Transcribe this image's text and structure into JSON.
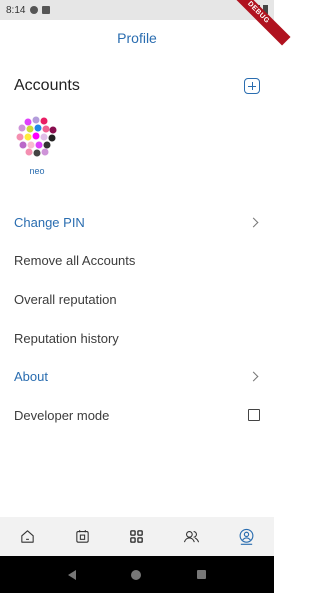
{
  "status_bar": {
    "time": "8:14",
    "debug_label": "DEBUG"
  },
  "app_bar": {
    "title": "Profile"
  },
  "accounts": {
    "title": "Accounts",
    "add_icon": "add-square-icon",
    "items": [
      {
        "name": "neo"
      }
    ]
  },
  "menu": {
    "change_pin": "Change PIN",
    "remove_accounts": "Remove all Accounts",
    "overall_reputation": "Overall reputation",
    "reputation_history": "Reputation history",
    "about": "About",
    "developer_mode": "Developer mode",
    "developer_mode_enabled": false
  },
  "bottom_nav": {
    "items": [
      "home-icon",
      "wallet-icon",
      "qr-scan-icon",
      "contacts-icon",
      "profile-icon"
    ],
    "active": "profile-icon"
  },
  "colors": {
    "accent": "#2a6db0",
    "text": "#3c3c3c",
    "nav_bg": "#f2f2f2",
    "ribbon": "#b0121f"
  }
}
